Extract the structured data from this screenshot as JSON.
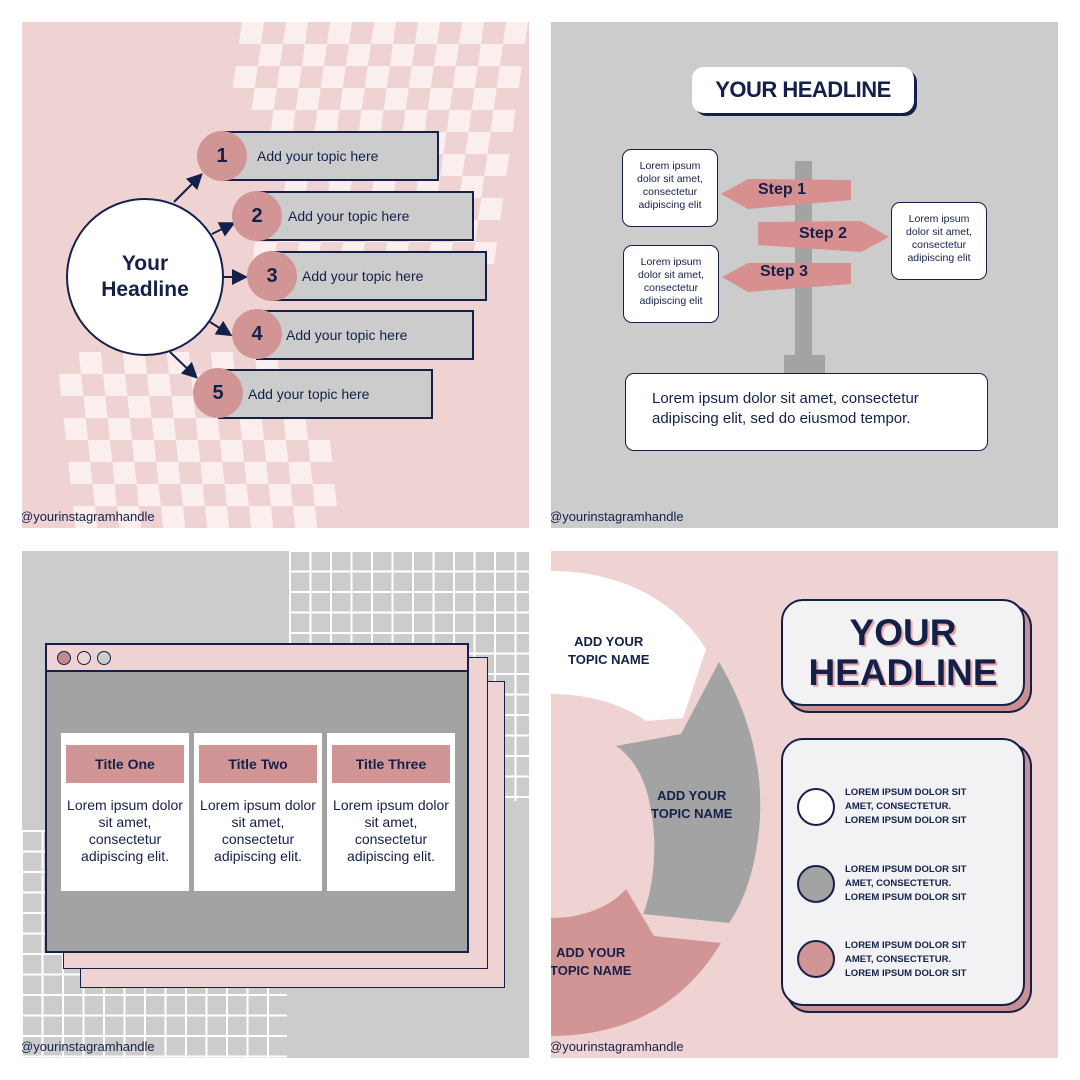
{
  "handle": "@yourinstagramhandle",
  "colors": {
    "navy": "#14204a",
    "pink_bg": "#efd3d3",
    "rose": "#d29595",
    "gray_bg": "#cccccc",
    "gray_dark": "#a3a3a3",
    "white": "#ffffff"
  },
  "panel1": {
    "headline_line1": "Your",
    "headline_line2": "Headline",
    "topics": [
      {
        "number": "1",
        "label": "Add your topic here"
      },
      {
        "number": "2",
        "label": "Add your topic here"
      },
      {
        "number": "3",
        "label": "Add your topic here"
      },
      {
        "number": "4",
        "label": "Add your topic here"
      },
      {
        "number": "5",
        "label": "Add your topic here"
      }
    ]
  },
  "panel2": {
    "headline": "YOUR HEADLINE",
    "steps": [
      {
        "label": "Step 1",
        "note": "Lorem ipsum dolor sit amet, consectetur adipiscing elit"
      },
      {
        "label": "Step 2",
        "note": "Lorem ipsum dolor sit amet, consectetur adipiscing elit"
      },
      {
        "label": "Step 3",
        "note": "Lorem ipsum dolor sit amet, consectetur adipiscing elit"
      }
    ],
    "bottom_text": "Lorem ipsum dolor sit amet, consectetur adipiscing elit, sed do eiusmod tempor."
  },
  "panel3": {
    "window_dots": [
      "#c48a8a",
      "#efd3d3",
      "#cccccc"
    ],
    "cards": [
      {
        "title": "Title One",
        "body": "Lorem ipsum dolor sit amet, consectetur adipiscing elit."
      },
      {
        "title": "Title Two",
        "body": "Lorem ipsum dolor sit amet, consectetur adipiscing elit."
      },
      {
        "title": "Title Three",
        "body": "Lorem ipsum dolor sit amet, consectetur adipiscing elit."
      }
    ]
  },
  "panel4": {
    "segments": [
      {
        "label_line1": "ADD YOUR",
        "label_line2": "TOPIC NAME",
        "color": "#ffffff"
      },
      {
        "label_line1": "ADD YOUR",
        "label_line2": "TOPIC NAME",
        "color": "#a3a3a3"
      },
      {
        "label_line1": "ADD YOUR",
        "label_line2": "TOPIC NAME",
        "color": "#d29595"
      }
    ],
    "headline_line1": "YOUR",
    "headline_line2": "HEADLINE",
    "bullets": [
      {
        "color": "#ffffff",
        "line1": "LOREM IPSUM DOLOR SIT",
        "line2": "AMET, CONSECTETUR.",
        "line3": "LOREM IPSUM DOLOR SIT"
      },
      {
        "color": "#a3a3a3",
        "line1": "LOREM IPSUM DOLOR SIT",
        "line2": "AMET, CONSECTETUR.",
        "line3": "LOREM IPSUM DOLOR SIT"
      },
      {
        "color": "#d29595",
        "line1": "LOREM IPSUM DOLOR SIT",
        "line2": "AMET, CONSECTETUR.",
        "line3": "LOREM IPSUM DOLOR SIT"
      }
    ]
  }
}
